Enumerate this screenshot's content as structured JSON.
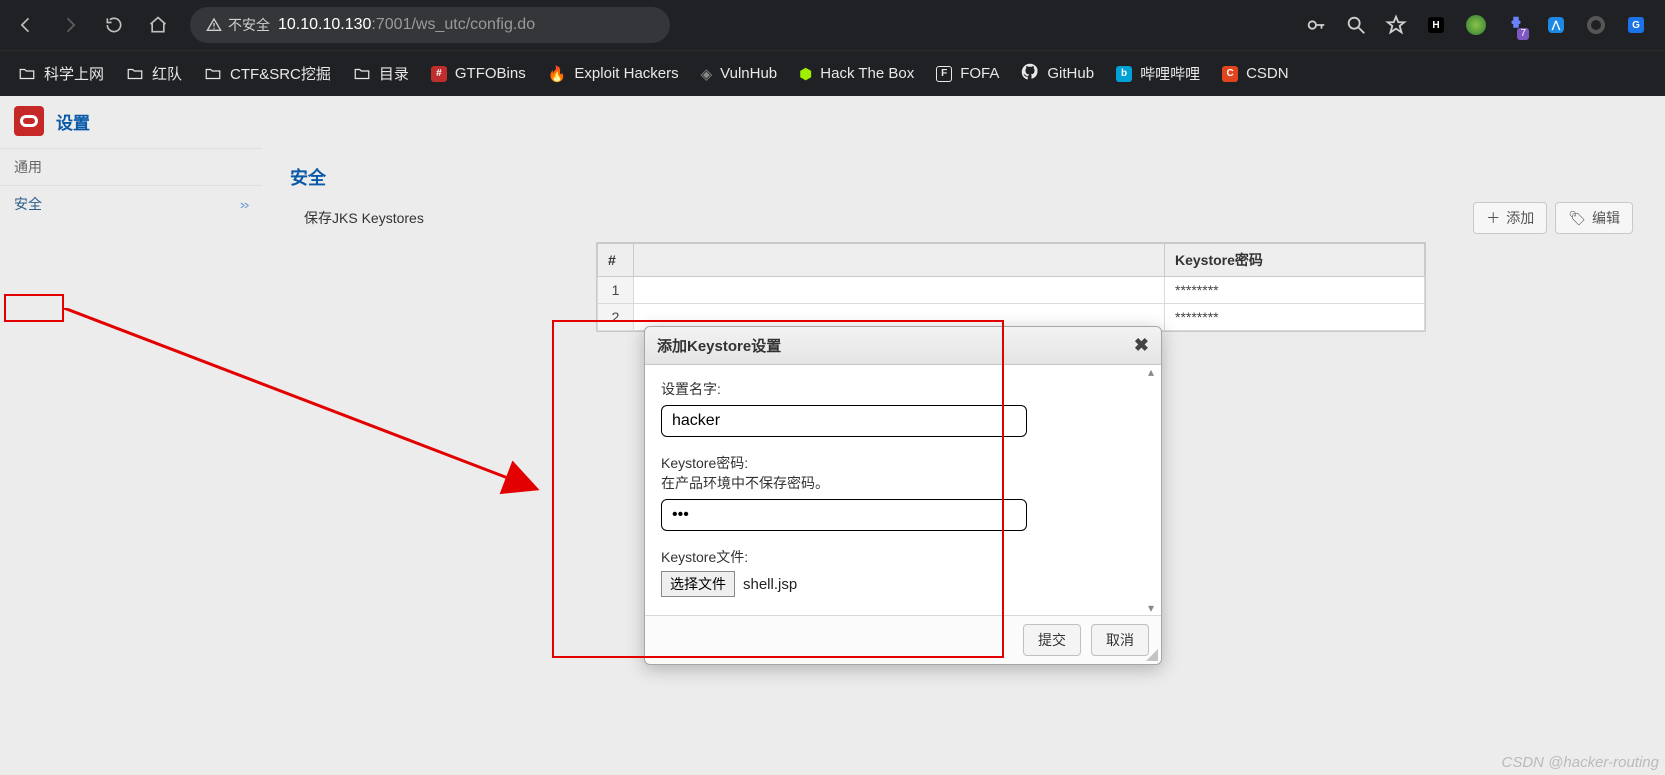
{
  "browser": {
    "url_prefix_label": "不安全",
    "url_host": "10.10.10.130",
    "url_port": ":7001",
    "url_path": "/ws_utc/config.do",
    "ext_badge": "7"
  },
  "bookmarks": [
    {
      "label": "科学上网",
      "icon": "folder"
    },
    {
      "label": "红队",
      "icon": "folder"
    },
    {
      "label": "CTF&SRC挖掘",
      "icon": "folder"
    },
    {
      "label": "目录",
      "icon": "folder"
    },
    {
      "label": "GTFOBins",
      "icon": "gtfo"
    },
    {
      "label": "Exploit Hackers",
      "icon": "flame"
    },
    {
      "label": "VulnHub",
      "icon": "diamond"
    },
    {
      "label": "Hack The Box",
      "icon": "cube"
    },
    {
      "label": "FOFA",
      "icon": "fofa"
    },
    {
      "label": "GitHub",
      "icon": "github"
    },
    {
      "label": "哔哩哔哩",
      "icon": "bili"
    },
    {
      "label": "CSDN",
      "icon": "csdn"
    }
  ],
  "header": {
    "title": "设置"
  },
  "sidebar": {
    "general": "通用",
    "security": "安全"
  },
  "main": {
    "heading": "安全",
    "sub": "保存JKS Keystores",
    "add_btn": "添加",
    "edit_btn": "编辑",
    "col_index": "#",
    "col_password": "Keystore密码",
    "rows": [
      {
        "n": "1",
        "pw": "********"
      },
      {
        "n": "2",
        "pw": "********"
      }
    ]
  },
  "modal": {
    "title": "添加Keystore设置",
    "name_label": "设置名字:",
    "name_value": "hacker",
    "password_label": "Keystore密码:",
    "password_hint": "在产品环境中不保存密码。",
    "password_value": "•••",
    "file_label": "Keystore文件:",
    "file_button": "选择文件",
    "file_name": "shell.jsp",
    "submit": "提交",
    "cancel": "取消"
  },
  "watermark": "CSDN @hacker-routing"
}
